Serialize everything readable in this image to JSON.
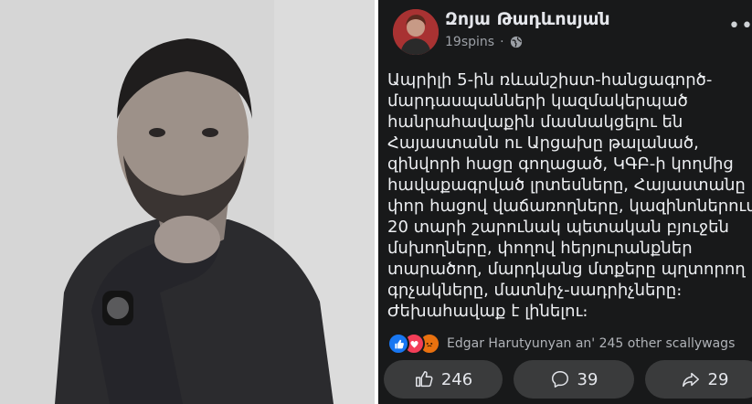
{
  "photo": {
    "alt": "man-portrait"
  },
  "post": {
    "author": "Զոյա Թադևոսյան",
    "meta": "19spins",
    "more": "••",
    "lines": [
      "Ապրիլի 5-ին ռևանշիստ-հանցագործ-",
      "մարդասպանների կազմակերպած",
      "հանրահավաքին մասնակցելու են",
      "Հայաստանն ու Արցախը թալանած,",
      "զինվորի հացը գողացած, ԿԳԲ-ի կողմից",
      "հավաքագրված լրտեսները, Հայաստանը մի",
      "փոր հացով վաճառողները, կազինոներում",
      "20 տարի շարունակ պետական բյուջեն",
      "մսխողները, փողով հերյուրանքներ",
      "տարածող, մարդկանց մտքերը պղտորող",
      "գրչակները, մատնիչ-սադրիչները։",
      "Ժեխահավաք է լինելու։"
    ],
    "reactions_text": "Edgar Harutyunyan an' 245 other scallywags",
    "like_count": "246",
    "comment_count": "39",
    "share_count": "29"
  },
  "colors": {
    "bg": "#18191a",
    "button": "#3a3b3c",
    "like": "#1877f2",
    "love": "#f33e58",
    "angry": "#e9710f"
  }
}
